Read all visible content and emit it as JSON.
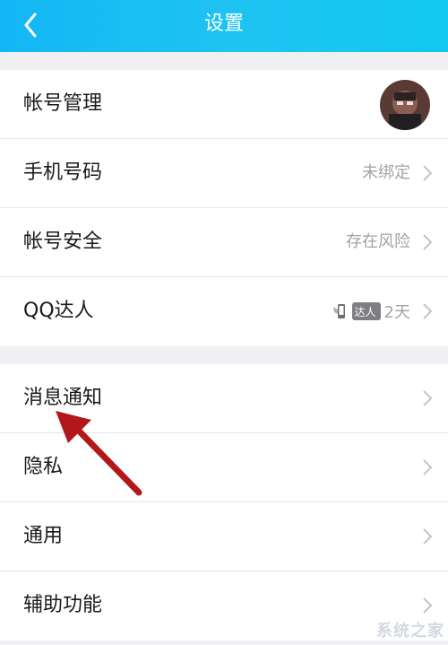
{
  "header": {
    "title": "设置",
    "back_icon": "chevron-left-icon"
  },
  "account_group": [
    {
      "label": "帐号管理",
      "value": ""
    },
    {
      "label": "手机号码",
      "value": "未绑定"
    },
    {
      "label": "帐号安全",
      "value": "存在风险"
    },
    {
      "label": "QQ达人",
      "badge": "达人",
      "value": "2天"
    }
  ],
  "settings_group": [
    {
      "label": "消息通知"
    },
    {
      "label": "隐私"
    },
    {
      "label": "通用"
    },
    {
      "label": "辅助功能"
    }
  ],
  "watermark": "系统之家",
  "colors": {
    "header": "#12b7f5",
    "annotation_arrow": "#b3171c"
  }
}
